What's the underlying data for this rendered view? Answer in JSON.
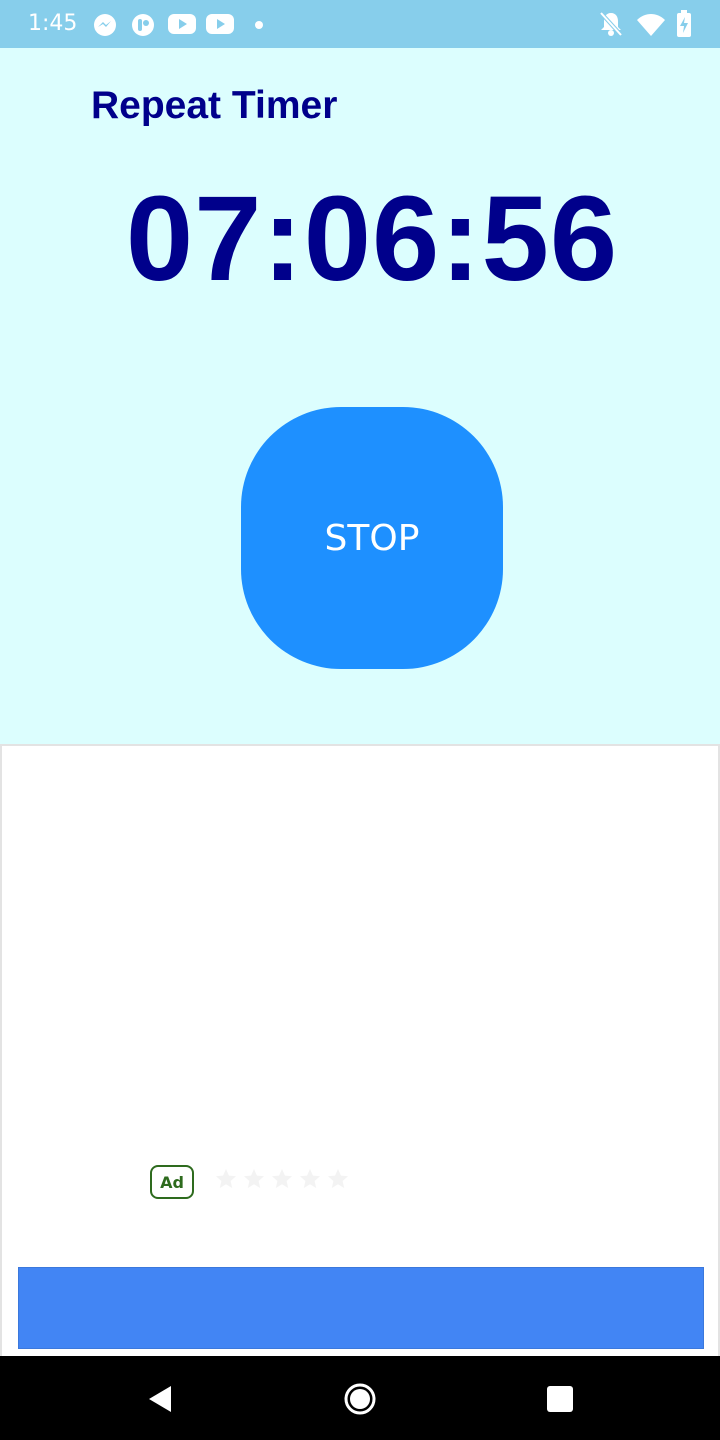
{
  "status_bar": {
    "time": "1:45",
    "left_icons": [
      "messenger-icon",
      "app-notification-icon",
      "youtube-icon",
      "youtube-icon",
      "dot-icon"
    ],
    "right_icons": [
      "notifications-off-icon",
      "wifi-icon",
      "battery-charging-icon"
    ],
    "background": "#87ceeb"
  },
  "app": {
    "title": "Repeat Timer",
    "timer": "07:06:56",
    "stop_label": "STOP",
    "colors": {
      "background": "#dcfefe",
      "title": "#00008b",
      "button": "#1e90ff"
    }
  },
  "ad": {
    "badge": "Ad",
    "rating_stars": 5,
    "cta_color": "#4285f4"
  },
  "nav_bar": {
    "buttons": [
      "back-icon",
      "home-icon",
      "recents-icon"
    ]
  }
}
